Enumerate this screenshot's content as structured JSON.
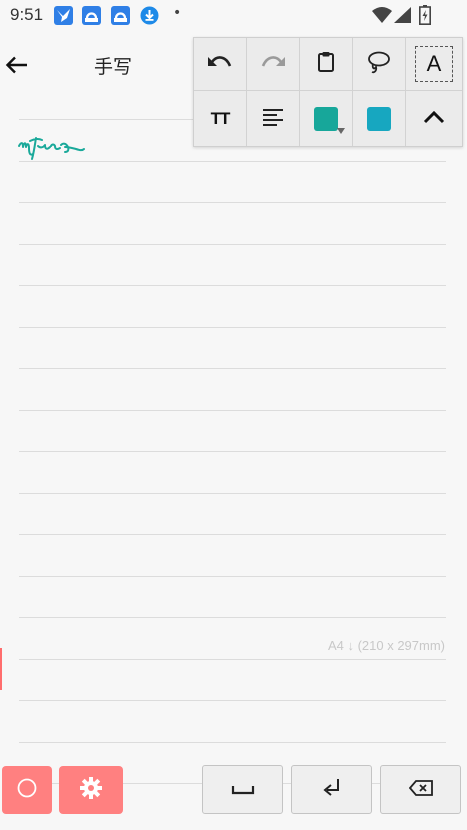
{
  "status": {
    "time": "9:51",
    "dot": "•",
    "notifications": [
      {
        "icon": "bird-notification-icon",
        "color": "#2f7fe6"
      },
      {
        "icon": "cloud-upload-notification-icon",
        "color": "#2f7fe6"
      },
      {
        "icon": "cloud-upload-notification-icon",
        "color": "#2f7fe6"
      },
      {
        "icon": "download-notification-icon",
        "color": "#1e8ae8"
      }
    ],
    "system_icons": [
      "wifi-icon",
      "cell-signal-icon",
      "battery-icon"
    ]
  },
  "appbar": {
    "title": "手写",
    "back_icon": "arrow-left-icon"
  },
  "toolbar": {
    "row1": [
      "undo-icon",
      "redo-icon",
      "clipboard-icon",
      "lasso-icon",
      "text-mode-icon"
    ],
    "row2": [
      "text-size-icon",
      "align-left-icon",
      "pen-color-icon",
      "fill-color-icon",
      "collapse-icon"
    ],
    "text_mode_label": "A",
    "text_size_label": "TT",
    "pen_color": "#17a79a",
    "fill_color": "#17a7c0"
  },
  "canvas": {
    "page_size_label": "A4 ↓ (210 x 297mm)",
    "ink_color": "#1aa99a",
    "rule_color": "#dcdcdc"
  },
  "bottom": {
    "buttons": [
      "circle-icon",
      "gear-icon",
      "space-icon",
      "enter-icon",
      "backspace-icon"
    ],
    "accent_color": "#ff8080"
  }
}
